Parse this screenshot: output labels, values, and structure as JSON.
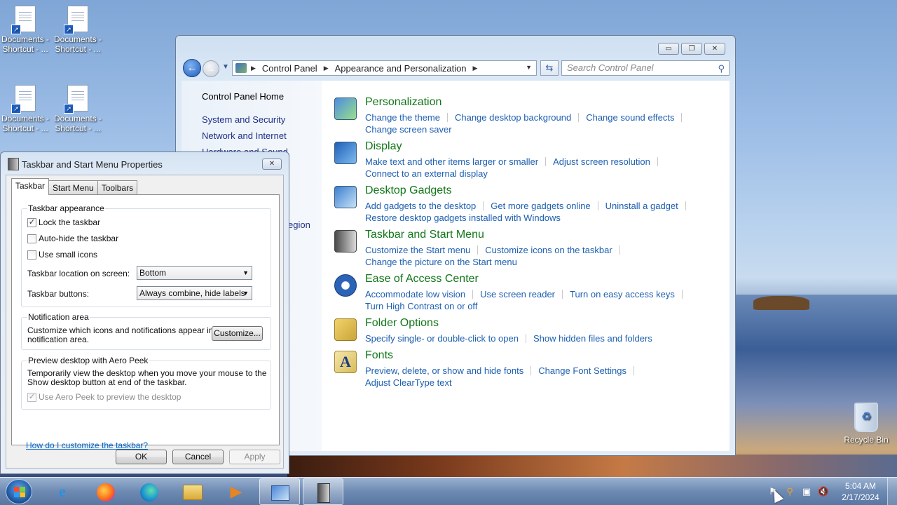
{
  "desktop": {
    "icons": [
      {
        "label": "Documents - Shortcut - ..."
      },
      {
        "label": "Documents - Shortcut - ..."
      },
      {
        "label": "Documents - Shortcut - ..."
      },
      {
        "label": "Documents - Shortcut - ..."
      }
    ],
    "recycle_bin": "Recycle Bin"
  },
  "control_panel": {
    "breadcrumb": [
      "Control Panel",
      "Appearance and Personalization"
    ],
    "search_placeholder": "Search Control Panel",
    "left_nav": [
      "Control Panel Home",
      "System and Security",
      "Network and Internet",
      "Hardware and Sound",
      "egion"
    ],
    "categories": [
      {
        "title": "Personalization",
        "links": [
          "Change the theme",
          "Change desktop background",
          "Change sound effects",
          "Change screen saver"
        ]
      },
      {
        "title": "Display",
        "links": [
          "Make text and other items larger or smaller",
          "Adjust screen resolution",
          "Connect to an external display"
        ]
      },
      {
        "title": "Desktop Gadgets",
        "links": [
          "Add gadgets to the desktop",
          "Get more gadgets online",
          "Uninstall a gadget",
          "Restore desktop gadgets installed with Windows"
        ]
      },
      {
        "title": "Taskbar and Start Menu",
        "links": [
          "Customize the Start menu",
          "Customize icons on the taskbar",
          "Change the picture on the Start menu"
        ]
      },
      {
        "title": "Ease of Access Center",
        "links": [
          "Accommodate low vision",
          "Use screen reader",
          "Turn on easy access keys",
          "Turn High Contrast on or off"
        ]
      },
      {
        "title": "Folder Options",
        "links": [
          "Specify single- or double-click to open",
          "Show hidden files and folders"
        ]
      },
      {
        "title": "Fonts",
        "links": [
          "Preview, delete, or show and hide fonts",
          "Change Font Settings",
          "Adjust ClearType text"
        ]
      }
    ]
  },
  "dialog": {
    "title": "Taskbar and Start Menu Properties",
    "tabs": [
      "Taskbar",
      "Start Menu",
      "Toolbars"
    ],
    "appearance": {
      "group_title": "Taskbar appearance",
      "lock": {
        "label": "Lock the taskbar",
        "checked": true
      },
      "autohide": {
        "label": "Auto-hide the taskbar",
        "checked": false
      },
      "small_icons": {
        "label": "Use small icons",
        "checked": false
      },
      "location_label": "Taskbar location on screen:",
      "location_value": "Bottom",
      "buttons_label": "Taskbar buttons:",
      "buttons_value": "Always combine, hide labels"
    },
    "notification": {
      "group_title": "Notification area",
      "text_line1": "Customize which icons and notifications appear in the",
      "text_line2": "notification area.",
      "button": "Customize..."
    },
    "aero_peek": {
      "group_title": "Preview desktop with Aero Peek",
      "text_line1": "Temporarily view the desktop when you move your mouse to the",
      "text_line2": "Show desktop button at end of the taskbar.",
      "checkbox": {
        "label": "Use Aero Peek to preview the desktop",
        "checked": true,
        "disabled": true
      }
    },
    "help_link": "How do I customize the taskbar?",
    "ok": "OK",
    "cancel": "Cancel",
    "apply": "Apply"
  },
  "taskbar": {
    "apps": [
      "internet-explorer-icon",
      "firefox-icon",
      "edge-icon",
      "file-explorer-icon",
      "media-player-icon",
      "control-panel-icon",
      "taskbar-properties-icon"
    ],
    "time": "5:04 AM",
    "date": "2/17/2024"
  }
}
